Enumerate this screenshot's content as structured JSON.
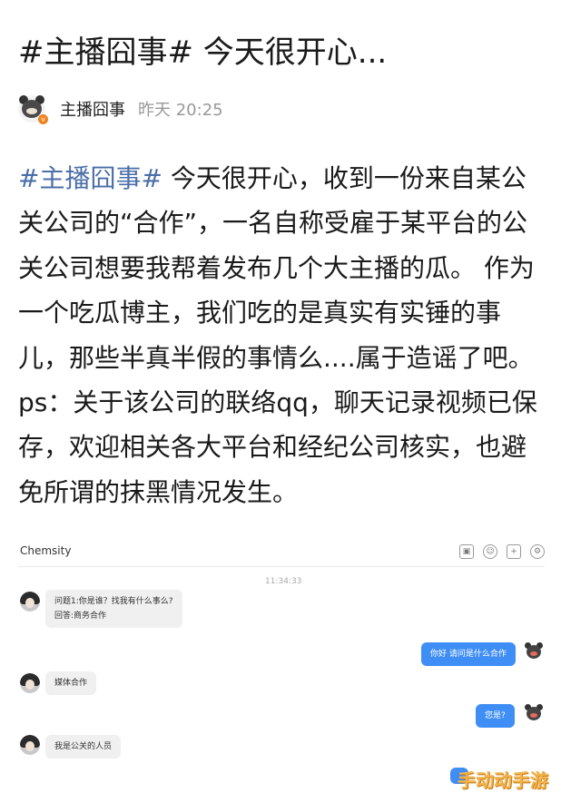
{
  "post": {
    "title": "#主播囧事# 今天很开心...",
    "author": "主播囧事",
    "time": "昨天 20:25",
    "hashtag": "#主播囧事#",
    "body": " 今天很开心，收到一份来自某公关公司的“合作”，一名自称受雇于某平台的公关公司想要我帮着发布几个大主播的瓜。 作为一个吃瓜博主，我们吃的是真实有实锤的事儿，那些半真半假的事情么....属于造谣了吧。ps：关于该公司的联络qq，聊天记录视频已保存，欢迎相关各大平台和经纪公司核实，也避免所谓的抹黑情况发生。"
  },
  "chat": {
    "app_name": "Chemsity",
    "time": "11:34:33",
    "messages": [
      {
        "side": "left",
        "lines": [
          "问题1:你是谁？找我有什么事么?",
          "回答:商务合作"
        ]
      },
      {
        "side": "right",
        "lines": [
          "你好 请问是什么合作"
        ]
      },
      {
        "side": "left",
        "lines": [
          "媒体合作"
        ]
      },
      {
        "side": "right",
        "lines": [
          "您是?"
        ]
      },
      {
        "side": "left",
        "lines": [
          "我是公关的人员"
        ]
      }
    ]
  },
  "watermark": "手动动手游",
  "icons": [
    "user-avatar-icon",
    "verified-badge-icon",
    "screenshot-icon",
    "emoji-icon",
    "add-icon",
    "settings-icon"
  ],
  "colors": {
    "hashtag": "#4a6ea8",
    "bubble_right": "#3f8ef5",
    "watermark": "#f2b24a"
  }
}
